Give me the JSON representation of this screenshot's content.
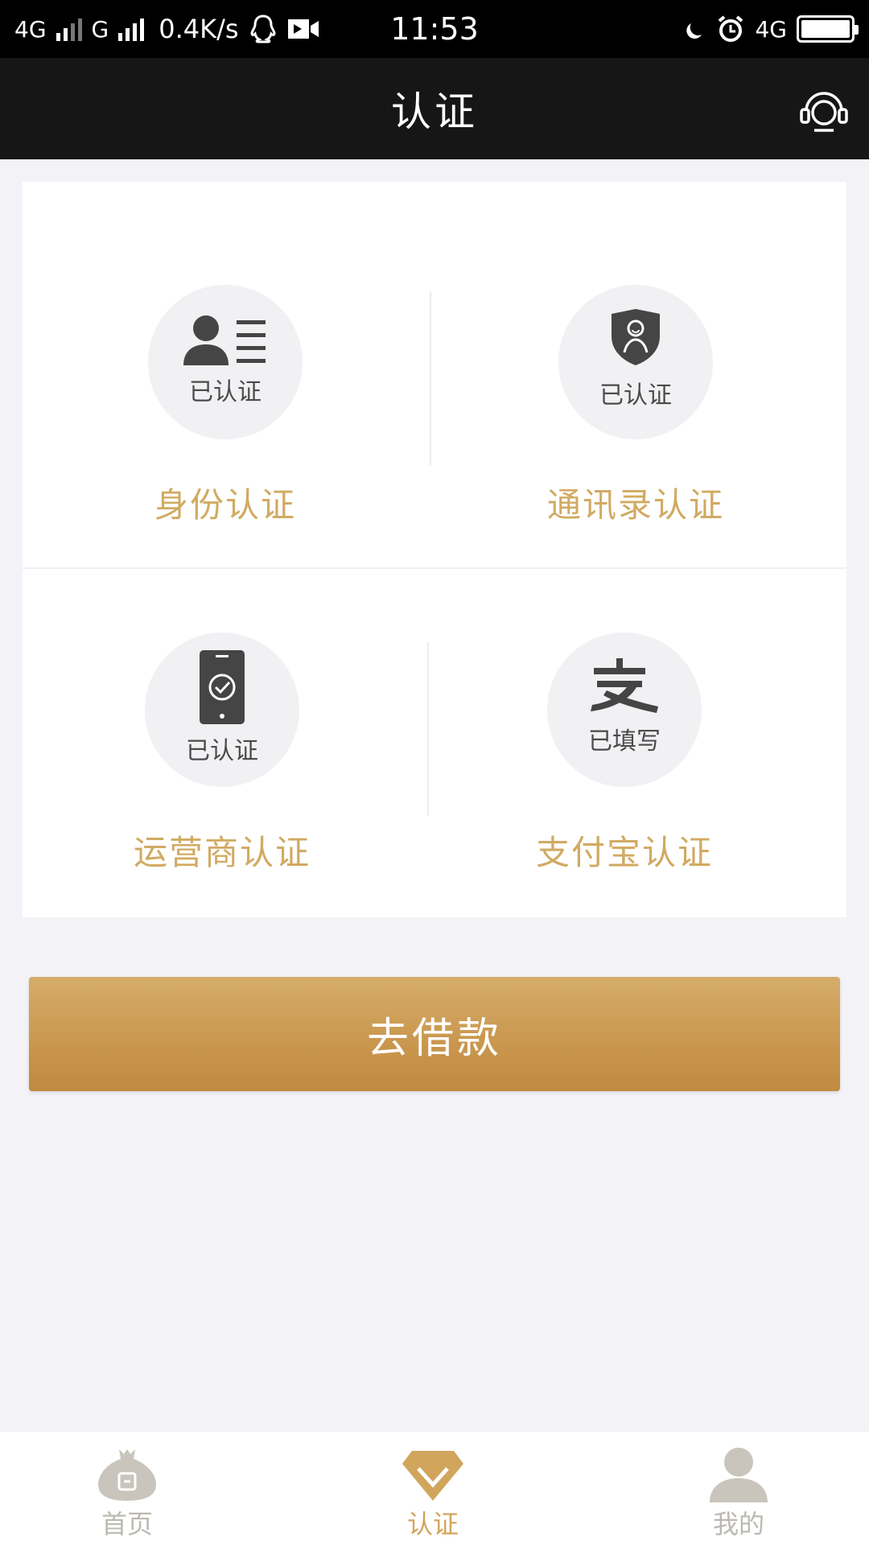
{
  "status_bar": {
    "network_1": "4G",
    "network_2": "G",
    "speed": "0.4K/s",
    "time": "11:53",
    "network_3": "4G"
  },
  "header": {
    "title": "认证"
  },
  "auth_items": [
    {
      "label": "身份认证",
      "status": "已认证",
      "icon": "id-card-icon"
    },
    {
      "label": "通讯录认证",
      "status": "已认证",
      "icon": "contacts-shield-icon"
    },
    {
      "label": "运营商认证",
      "status": "已认证",
      "icon": "phone-check-icon"
    },
    {
      "label": "支付宝认证",
      "status": "已填写",
      "icon": "alipay-icon"
    }
  ],
  "primary_button": {
    "label": "去借款"
  },
  "bottom_nav": {
    "items": [
      {
        "label": "首页",
        "icon": "money-bag-icon"
      },
      {
        "label": "认证",
        "icon": "diamond-check-icon",
        "active": true
      },
      {
        "label": "我的",
        "icon": "user-icon"
      }
    ]
  },
  "colors": {
    "accent": "#d1aa62",
    "button_gradient_top": "#d5ad6a",
    "button_gradient_bottom": "#c08a40",
    "header_bg": "#161616",
    "page_bg": "#f3f3f7"
  }
}
